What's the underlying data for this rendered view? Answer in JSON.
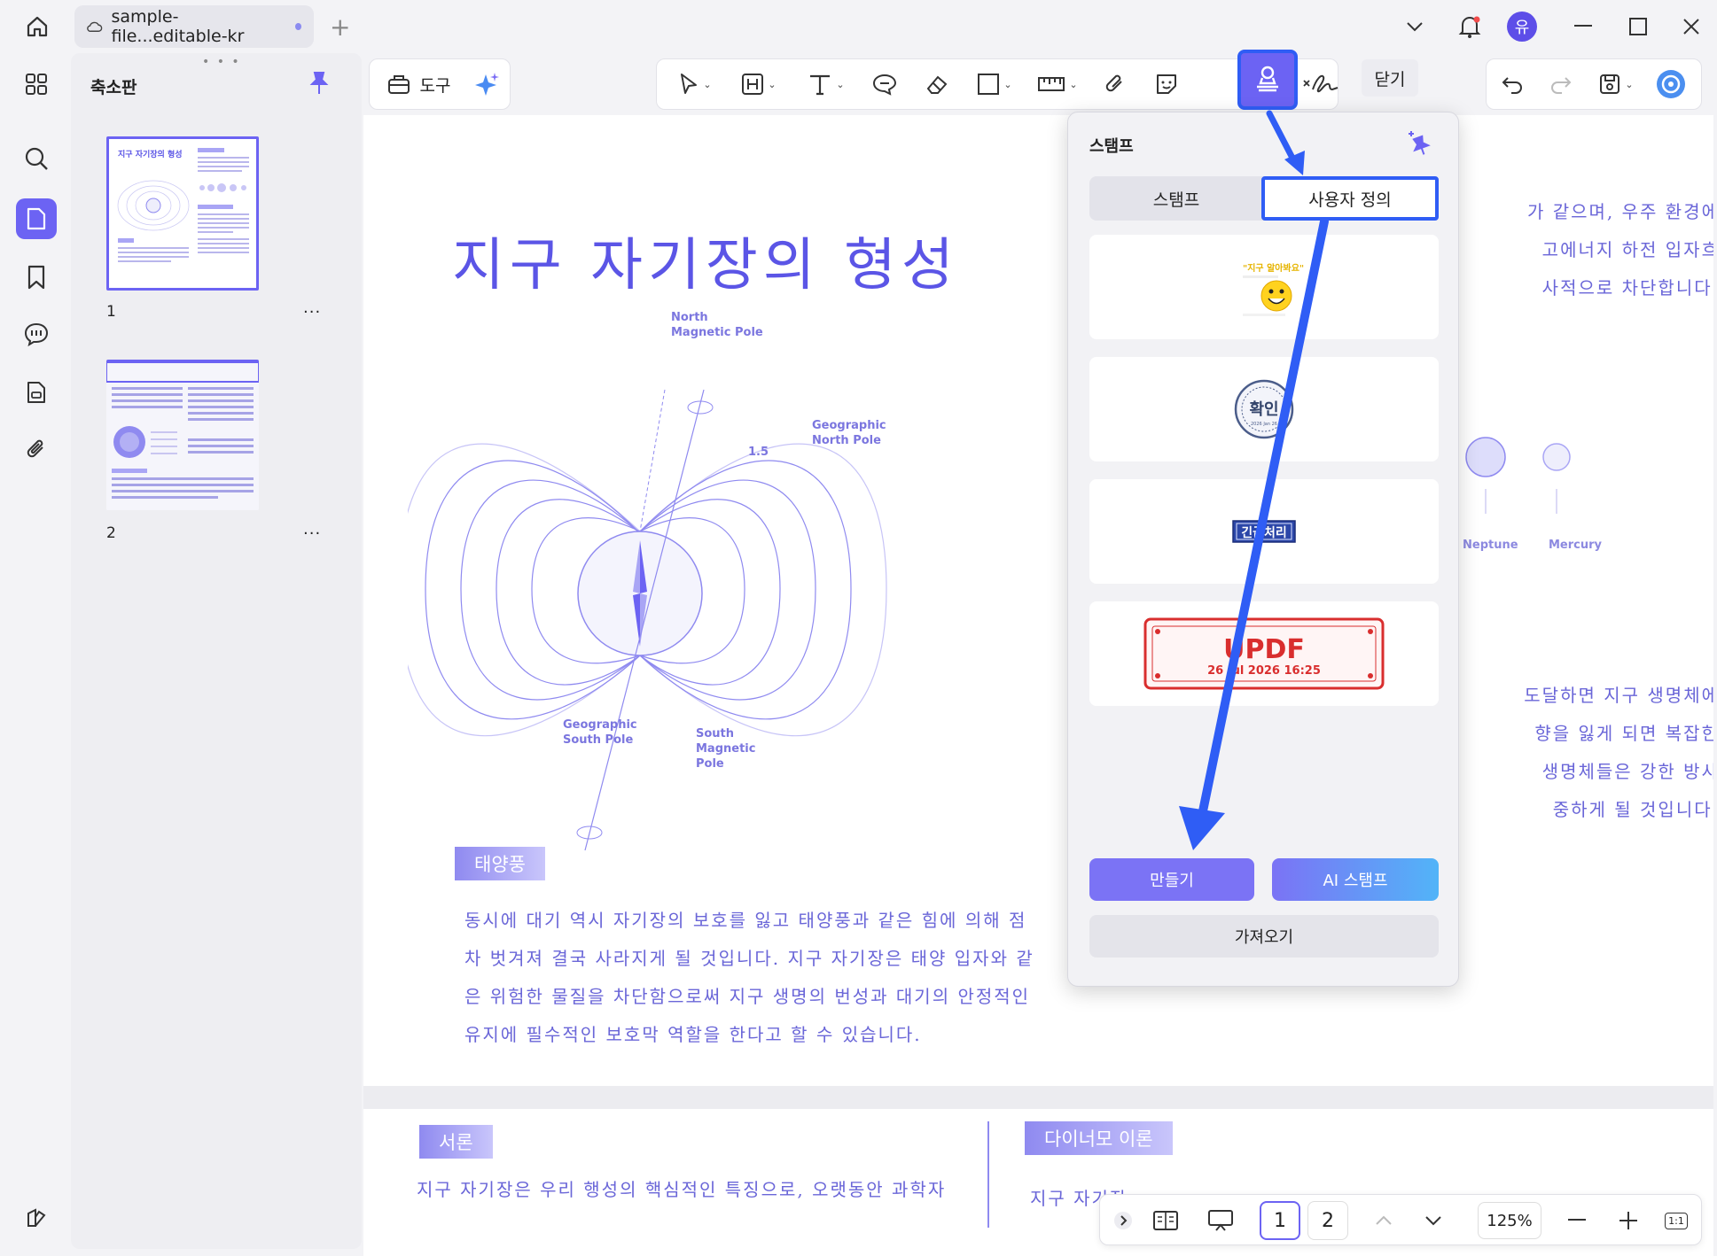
{
  "titlebar": {
    "tab_title": "sample-file...editable-kr",
    "avatar_letter": "유"
  },
  "thumbnails": {
    "title": "축소판",
    "pages": [
      {
        "number": "1",
        "more": "···"
      },
      {
        "number": "2",
        "more": "···"
      }
    ]
  },
  "toolbar": {
    "tools_label": "도구",
    "close_label": "닫기"
  },
  "document": {
    "title": "지구 자기장의 형성",
    "diagram": {
      "north_magnetic": "North\nMagnetic Pole",
      "geo_north": "Geographic\nNorth Pole",
      "angle": "1.5",
      "geo_south": "Geographic\nSouth Pole",
      "south_magnetic": "South\nMagnetic\nPole"
    },
    "planets": [
      "Neptune",
      "Mercury"
    ],
    "right_text_top": [
      "가 같으며, 우주 환경에",
      "고에너지 하전 입자흐",
      "사적으로 차단합니다."
    ],
    "right_text_bottom": [
      "도달하면 지구 생명체에",
      "향을 잃게 되면 복잡한",
      "생명체들은 강한 방사",
      "중하게 될 것입니다."
    ],
    "section_solar_wind": "태양풍",
    "solar_text": [
      "동시에 대기 역시 자기장의 보호를 잃고 태양풍과 같은 힘에 의해 점",
      "차 벗겨져 결국 사라지게 될 것입니다. 지구 자기장은 태양 입자와 같",
      "은 위험한 물질을 차단함으로써 지구 생명의 번성과 대기의 안정적인",
      "유지에 필수적인 보호막 역할을 한다고 할 수 있습니다."
    ],
    "section_intro": "서론",
    "intro_text": "지구 자기장은 우리 행성의 핵심적인 특징으로, 오랫동안 과학자",
    "section_dynamo": "다이너모 이론",
    "dynamo_text": "지구 자기장"
  },
  "stamp_panel": {
    "title": "스탬프",
    "tab_stamp": "스탬프",
    "tab_custom": "사용자 정의",
    "stamps": [
      {
        "name": "emoji-stamp",
        "caption": "\"지구 알아봐요\""
      },
      {
        "name": "confirm-seal",
        "text": "확인",
        "small": "2026 Jan 26"
      },
      {
        "name": "urgent-stamp",
        "text": "긴급처리"
      },
      {
        "name": "updf-stamp",
        "text": "UPDF",
        "date": "26 Jul 2026 16:25"
      }
    ],
    "create_label": "만들기",
    "ai_label": "AI 스탬프",
    "import_label": "가져오기"
  },
  "bottom_nav": {
    "page1": "1",
    "page2": "2",
    "zoom": "125%",
    "fit": "1:1"
  },
  "colors": {
    "accent": "#6c63f3",
    "highlight": "#2f5df5",
    "doc_text": "#6a66d8"
  }
}
